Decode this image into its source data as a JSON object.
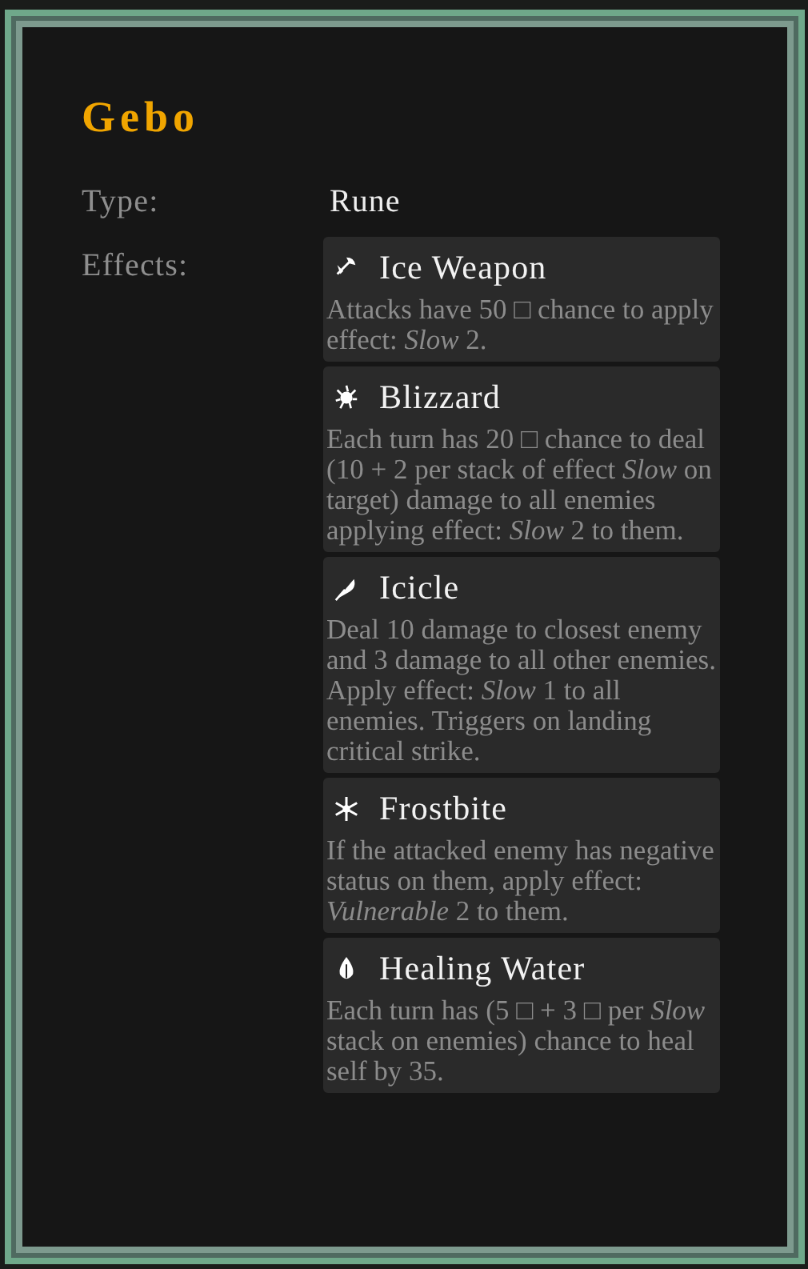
{
  "title": "Gebo",
  "properties": [
    {
      "label": "Type:",
      "value": "Rune"
    },
    {
      "label": "Effects:"
    }
  ],
  "effects": [
    {
      "kind": "axe",
      "name": "Ice Weapon",
      "description": "Attacks have 50 □ chance to apply effect: *Slow* 2."
    },
    {
      "kind": "splash",
      "name": "Blizzard",
      "description": "Each turn has 20 □ chance to deal (10 + 2 per stack of effect *Slow* on target) damage to all enemies applying effect: *Slow* 2 to them."
    },
    {
      "kind": "feather",
      "name": "Icicle",
      "description": "Deal 10 damage to closest enemy and 3 damage to all other enemies. Apply effect: *Slow* 1 to all enemies. Triggers on landing critical strike."
    },
    {
      "kind": "snowflake",
      "name": "Frostbite",
      "description": "If the attacked enemy has negative status on them, apply effect: *Vulnerable* 2 to them."
    },
    {
      "kind": "drop",
      "name": "Healing Water",
      "description": "Each turn has (5 □ + 3 □ per *Slow* stack on enemies) chance to heal self by 35."
    }
  ]
}
